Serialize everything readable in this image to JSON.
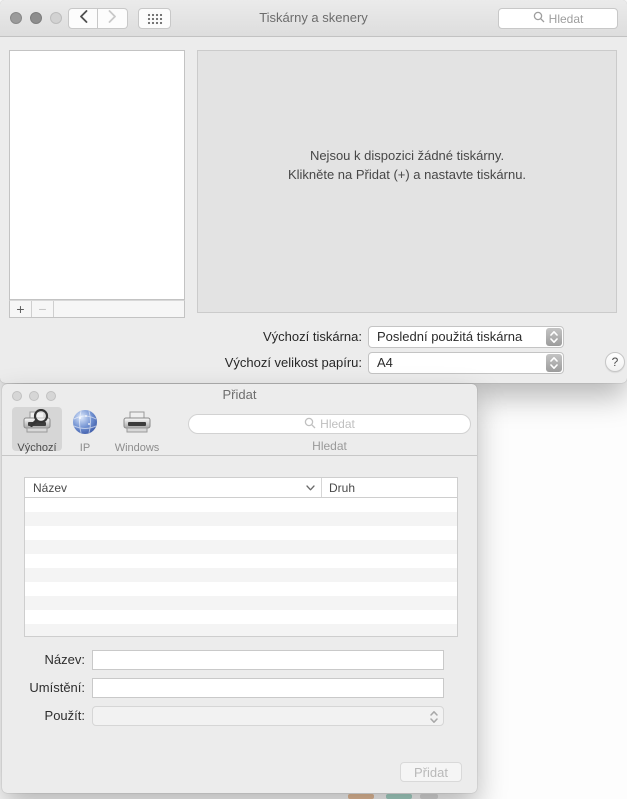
{
  "main_window": {
    "title": "Tiskárny a skenery",
    "search": {
      "placeholder": "Hledat"
    },
    "sidebar": {
      "add_label": "+",
      "remove_label": "−"
    },
    "empty_state": {
      "line1": "Nejsou k dispozici žádné tiskárny.",
      "line2": "Klikněte na Přidat (+) a nastavte tiskárnu."
    },
    "settings": {
      "default_printer": {
        "label": "Výchozí tiskárna:",
        "value": "Poslední použitá tiskárna"
      },
      "default_paper": {
        "label": "Výchozí velikost papíru:",
        "value": "A4"
      },
      "help_label": "?"
    }
  },
  "add_dialog": {
    "title": "Přidat",
    "toolbar": {
      "items": [
        {
          "label": "Výchozí",
          "selected": true
        },
        {
          "label": "IP",
          "selected": false
        },
        {
          "label": "Windows",
          "selected": false
        }
      ],
      "search": {
        "placeholder": "Hledat",
        "caption": "Hledat"
      }
    },
    "table": {
      "columns": [
        {
          "label": "Název"
        },
        {
          "label": "Druh"
        }
      ],
      "rows": []
    },
    "form": {
      "name": {
        "label": "Název:",
        "value": ""
      },
      "location": {
        "label": "Umístění:",
        "value": ""
      },
      "use": {
        "label": "Použít:",
        "value": ""
      }
    },
    "add_button": {
      "label": "Přidat",
      "enabled": false
    }
  },
  "colors": {
    "window_bg": "#ececec",
    "panel_bg": "#e3e3e3",
    "border": "#c6c6c6",
    "inactive_title": "#6c6c6c",
    "globe_blue": "#5b7fc4"
  }
}
